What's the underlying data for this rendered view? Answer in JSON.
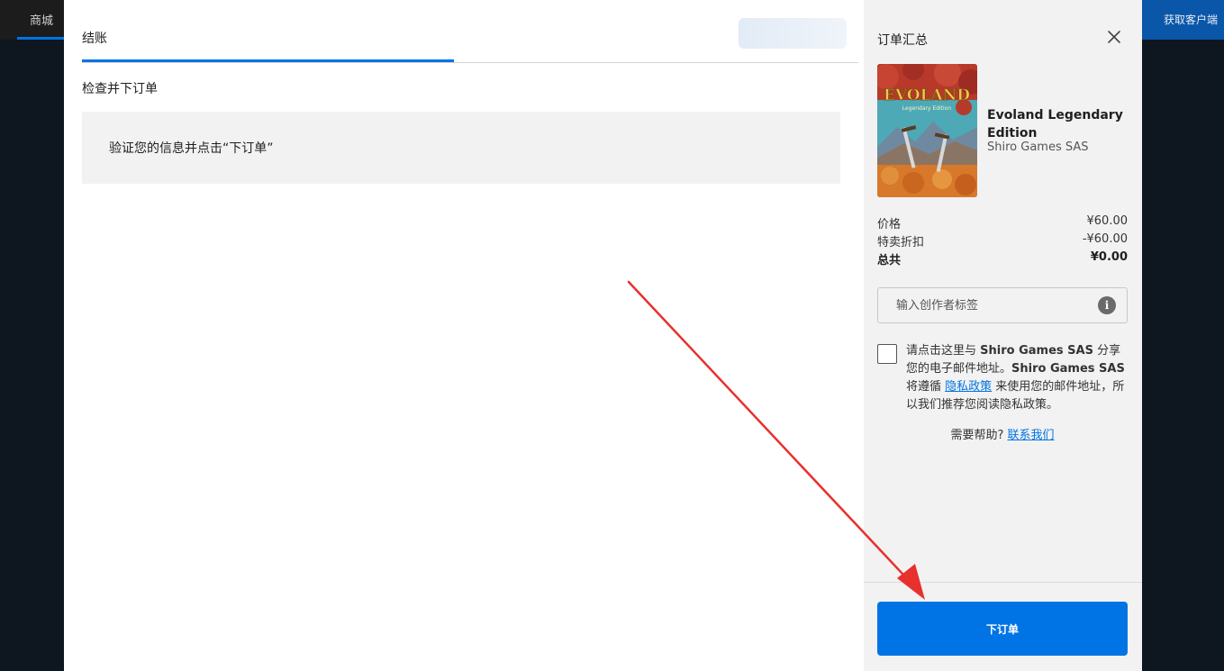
{
  "background": {
    "nav_store": "商城",
    "nav_get_client": "获取客户端"
  },
  "checkout": {
    "tab_label": "结账",
    "section_title": "检查并下订单",
    "notice": "验证您的信息并点击“下订单”"
  },
  "summary": {
    "title": "订单汇总",
    "product": {
      "name": "Evoland Legendary Edition",
      "publisher": "Shiro Games SAS",
      "logo_text": "EVOLAND",
      "logo_subtext": "Legendary Edition"
    },
    "prices": {
      "price_label": "价格",
      "price_value": "¥60.00",
      "discount_label": "特卖折扣",
      "discount_value": "-¥60.00",
      "total_label": "总共",
      "total_value": "¥0.00"
    },
    "creator_tag": {
      "placeholder": "输入创作者标签",
      "info_glyph": "i"
    },
    "consent": {
      "part1": "请点击这里与 ",
      "company1": "Shiro Games SAS",
      "part2": " 分享您的电子邮件地址。",
      "company2": "Shiro Games SAS",
      "part3": " 将遵循 ",
      "privacy_link": "隐私政策",
      "part4": " 来使用您的邮件地址，所以我们推荐您阅读隐私政策。"
    },
    "help": {
      "prefix": "需要帮助? ",
      "link": "联系我们"
    },
    "place_order_label": "下订单"
  },
  "colors": {
    "accent": "#0074e4",
    "annotation": "#e8302c",
    "panel": "#f2f2f2"
  }
}
